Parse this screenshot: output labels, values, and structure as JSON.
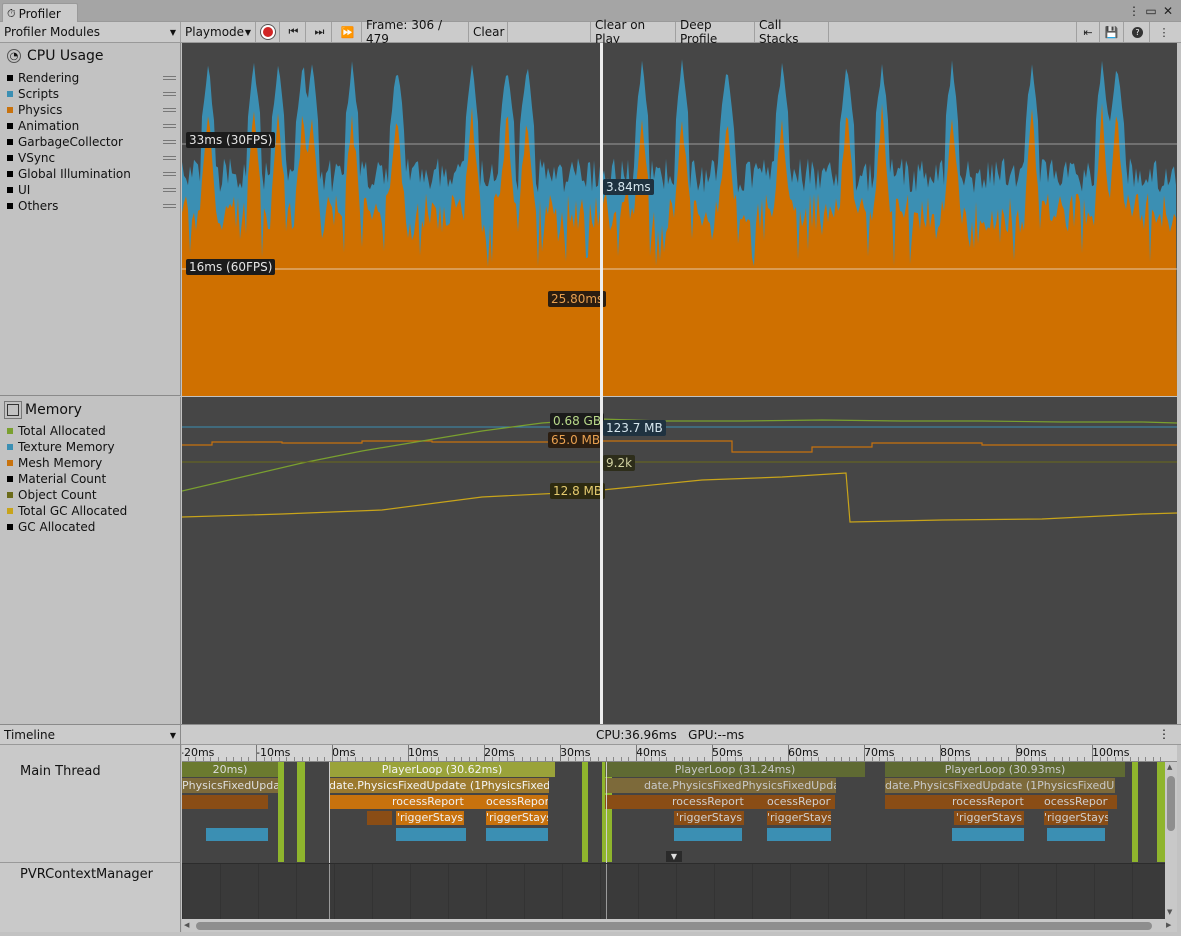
{
  "window": {
    "tab_title": "Profiler"
  },
  "toolbar": {
    "modules_label": "Profiler Modules",
    "playmode_label": "Playmode",
    "frame_label": "Frame: 306 / 479",
    "clear_label": "Clear",
    "clear_on_play_label": "Clear on Play",
    "deep_profile_label": "Deep Profile",
    "call_stacks_label": "Call Stacks"
  },
  "cpu": {
    "title": "CPU Usage",
    "legend": [
      {
        "label": "Rendering",
        "color": "#000000"
      },
      {
        "label": "Scripts",
        "color": "#3b8fb3"
      },
      {
        "label": "Physics",
        "color": "#c8720d"
      },
      {
        "label": "Animation",
        "color": "#000000"
      },
      {
        "label": "GarbageCollector",
        "color": "#000000"
      },
      {
        "label": "VSync",
        "color": "#000000"
      },
      {
        "label": "Global Illumination",
        "color": "#000000"
      },
      {
        "label": "UI",
        "color": "#000000"
      },
      {
        "label": "Others",
        "color": "#000000"
      }
    ],
    "line_30fps": "33ms (30FPS)",
    "line_60fps": "16ms (60FPS)",
    "selected_scripts": "3.84ms",
    "selected_physics": "25.80ms"
  },
  "memory": {
    "title": "Memory",
    "legend": [
      {
        "label": "Total Allocated",
        "color": "#7aa02f"
      },
      {
        "label": "Texture Memory",
        "color": "#3b8fb3"
      },
      {
        "label": "Mesh Memory",
        "color": "#c8720d"
      },
      {
        "label": "Material Count",
        "color": "#000000"
      },
      {
        "label": "Object Count",
        "color": "#6b6b1a"
      },
      {
        "label": "Total GC Allocated",
        "color": "#c8a41a"
      },
      {
        "label": "GC Allocated",
        "color": "#000000"
      }
    ],
    "val_total_allocated": "0.68 GB",
    "val_texture": "123.7 MB",
    "val_mesh": "65.0 MB",
    "val_object_count": "9.2k",
    "val_gc": "12.8 MB"
  },
  "timeline": {
    "mode_label": "Timeline",
    "stats": "CPU:36.96ms   GPU:--ms",
    "ticks": [
      "-20ms",
      "-10ms",
      "0ms",
      "10ms",
      "20ms",
      "30ms",
      "40ms",
      "50ms",
      "60ms",
      "70ms",
      "80ms",
      "90ms",
      "100ms"
    ],
    "threads": [
      "Main Thread",
      "PVRContextManager"
    ],
    "playerloops": [
      "PlayerLoop (30.62ms)",
      "PlayerLoop (31.24ms)",
      "PlayerLoop (30.93ms)"
    ],
    "fixed_update_label": "date.PhysicsFixedUpdate (1PhysicsFixedUpda",
    "fixed_update_label_b": "date.PhysicsFixedUpdate (1",
    "fixed_update_label_c": "PhysicsFixedUpda",
    "fixed_update_label_d": "date.PhysicsFixedUpdate (1PhysicsFixedUpda",
    "fixed_update_label_e": "PhysicsFixedUpda",
    "process_reports": "rocessReports",
    "process_reports_b": "ocessReport",
    "process_reports_c": "ocessReports",
    "process_reports_d": "rocessReports",
    "process_reports_e": "ocessReport",
    "trigger_stays": "'riggerStays",
    "first_loop_partial": "20ms)"
  }
}
